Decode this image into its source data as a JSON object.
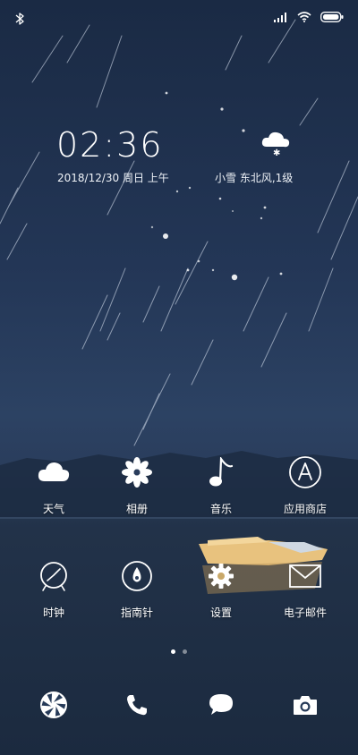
{
  "status_bar": {
    "left_icon": "bluetooth-icon",
    "right_icons": [
      "signal-icon",
      "wifi-icon",
      "battery-icon"
    ]
  },
  "clock": {
    "time": "02:36",
    "date": "2018/12/30  周日  上午"
  },
  "weather": {
    "icon": "snow-cloud-icon",
    "text": "小雪  东北风,1级"
  },
  "apps_row1": [
    {
      "label": "天气",
      "icon": "cloud-icon"
    },
    {
      "label": "相册",
      "icon": "flower-icon"
    },
    {
      "label": "音乐",
      "icon": "music-note-icon"
    },
    {
      "label": "应用商店",
      "icon": "app-store-icon"
    }
  ],
  "apps_row2": [
    {
      "label": "时钟",
      "icon": "clock-icon"
    },
    {
      "label": "指南针",
      "icon": "compass-icon"
    },
    {
      "label": "设置",
      "icon": "gear-icon"
    },
    {
      "label": "电子邮件",
      "icon": "mail-icon"
    }
  ],
  "page_indicator": {
    "count": 2,
    "active": 0
  },
  "dock": [
    "browser-icon",
    "phone-icon",
    "message-icon",
    "camera-icon"
  ],
  "colors": {
    "bg_top": "#1a2a44",
    "bg_bottom": "#1b2a3f",
    "icon": "#ffffff"
  }
}
